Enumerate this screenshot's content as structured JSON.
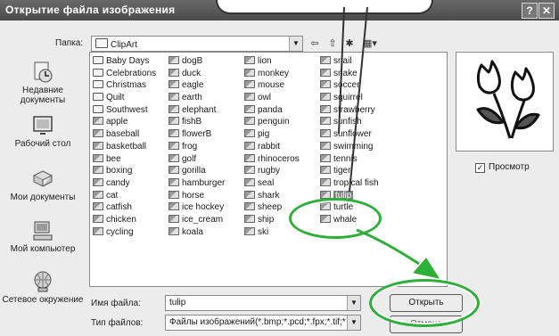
{
  "window": {
    "title": "Открытие файла изображения",
    "help_glyph": "?",
    "close_glyph": "✕"
  },
  "toolbar": {
    "folder_label": "Папка:",
    "folder_value": "ClipArt",
    "back_glyph": "⇦",
    "up_glyph": "⇧",
    "new_folder_glyph": "✱",
    "views_glyph": "▦▾"
  },
  "places": [
    {
      "label": "Недавние документы",
      "icon": "recent-documents-icon"
    },
    {
      "label": "Рабочий стол",
      "icon": "desktop-icon"
    },
    {
      "label": "Мои документы",
      "icon": "my-documents-icon"
    },
    {
      "label": "Мой компьютер",
      "icon": "my-computer-icon"
    },
    {
      "label": "Сетевое окружение",
      "icon": "network-icon"
    }
  ],
  "files": {
    "columns": [
      [
        {
          "name": "Baby Days",
          "type": "folder"
        },
        {
          "name": "Celebrations",
          "type": "folder"
        },
        {
          "name": "Christmas",
          "type": "folder"
        },
        {
          "name": "Quilt",
          "type": "folder"
        },
        {
          "name": "Southwest",
          "type": "folder"
        },
        {
          "name": "apple",
          "type": "file"
        },
        {
          "name": "baseball",
          "type": "file"
        },
        {
          "name": "basketball",
          "type": "file"
        },
        {
          "name": "bee",
          "type": "file"
        },
        {
          "name": "boxing",
          "type": "file"
        },
        {
          "name": "candy",
          "type": "file"
        },
        {
          "name": "cat",
          "type": "file"
        },
        {
          "name": "catfish",
          "type": "file"
        },
        {
          "name": "chicken",
          "type": "file"
        },
        {
          "name": "cycling",
          "type": "file"
        }
      ],
      [
        {
          "name": "dogB",
          "type": "file"
        },
        {
          "name": "duck",
          "type": "file"
        },
        {
          "name": "eagle",
          "type": "file"
        },
        {
          "name": "earth",
          "type": "file"
        },
        {
          "name": "elephant",
          "type": "file"
        },
        {
          "name": "fishB",
          "type": "file"
        },
        {
          "name": "flowerB",
          "type": "file"
        },
        {
          "name": "frog",
          "type": "file"
        },
        {
          "name": "golf",
          "type": "file"
        },
        {
          "name": "gorilla",
          "type": "file"
        },
        {
          "name": "hamburger",
          "type": "file"
        },
        {
          "name": "horse",
          "type": "file"
        },
        {
          "name": "ice hockey",
          "type": "file"
        },
        {
          "name": "ice_cream",
          "type": "file"
        },
        {
          "name": "koala",
          "type": "file"
        }
      ],
      [
        {
          "name": "lion",
          "type": "file"
        },
        {
          "name": "monkey",
          "type": "file"
        },
        {
          "name": "mouse",
          "type": "file"
        },
        {
          "name": "owl",
          "type": "file"
        },
        {
          "name": "panda",
          "type": "file"
        },
        {
          "name": "penguin",
          "type": "file"
        },
        {
          "name": "pig",
          "type": "file"
        },
        {
          "name": "rabbit",
          "type": "file"
        },
        {
          "name": "rhinoceros",
          "type": "file"
        },
        {
          "name": "rugby",
          "type": "file"
        },
        {
          "name": "seal",
          "type": "file"
        },
        {
          "name": "shark",
          "type": "file"
        },
        {
          "name": "sheep",
          "type": "file"
        },
        {
          "name": "ship",
          "type": "file"
        },
        {
          "name": "ski",
          "type": "file"
        }
      ],
      [
        {
          "name": "snail",
          "type": "file"
        },
        {
          "name": "snake",
          "type": "file"
        },
        {
          "name": "soccer",
          "type": "file"
        },
        {
          "name": "squirrel",
          "type": "file"
        },
        {
          "name": "strawberry",
          "type": "file"
        },
        {
          "name": "sunfish",
          "type": "file"
        },
        {
          "name": "sunflower",
          "type": "file"
        },
        {
          "name": "swimming",
          "type": "file"
        },
        {
          "name": "tennis",
          "type": "file"
        },
        {
          "name": "tiger",
          "type": "file"
        },
        {
          "name": "tropical fish",
          "type": "file"
        },
        {
          "name": "tulip",
          "type": "file",
          "selected": true
        },
        {
          "name": "turtle",
          "type": "file"
        },
        {
          "name": "whale",
          "type": "file"
        }
      ]
    ]
  },
  "form": {
    "filename_label": "Имя файла:",
    "filename_value": "tulip",
    "filetype_label": "Тип файлов:",
    "filetype_value": "Файлы изображений(*.bmp;*.pcd;*.fpx;*.tif;*.jpg)"
  },
  "preview": {
    "checkbox_label": "Просмотр",
    "checked_glyph": "✓"
  },
  "buttons": {
    "open": "Открыть",
    "cancel": "Отмена"
  },
  "colors": {
    "titlebar": "#555555",
    "highlight_ring": "#2eaf3a",
    "selection": "#808080"
  }
}
